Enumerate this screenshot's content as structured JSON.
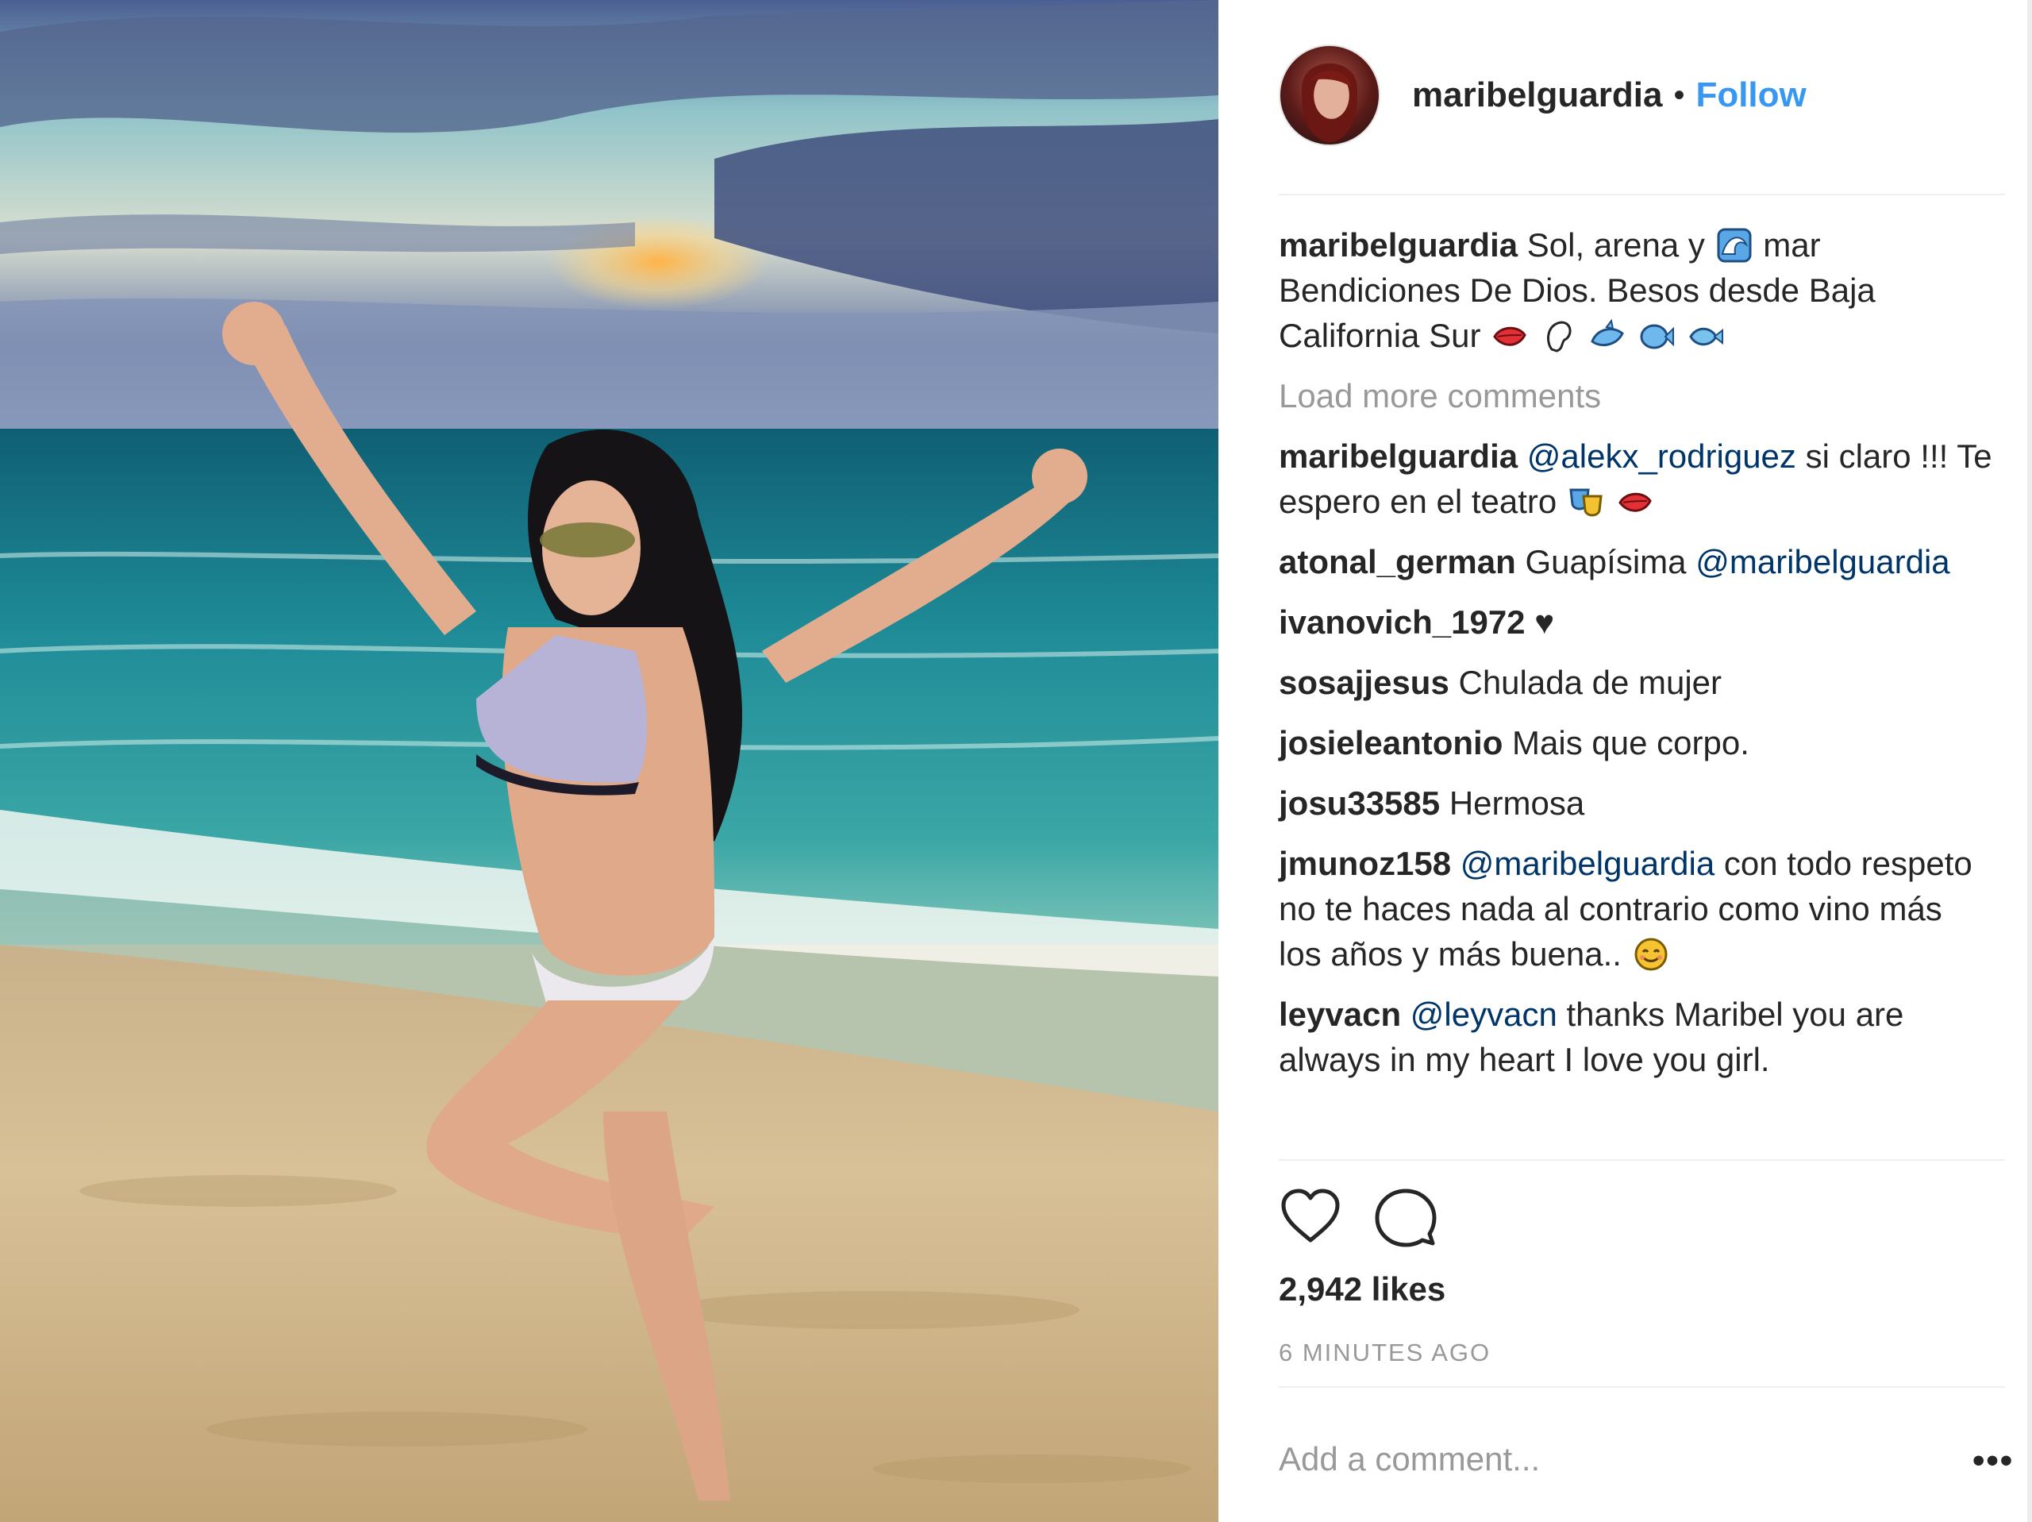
{
  "post": {
    "username": "maribelguardia",
    "separator": "•",
    "follow_label": "Follow",
    "avatar_icon": "profile-avatar",
    "caption": {
      "username": "maribelguardia",
      "text": "Sol, arena y",
      "text2": "mar Bendiciones De Dios. Besos desde Baja California Sur"
    },
    "load_more": "Load more comments",
    "comments": [
      {
        "user": "maribelguardia",
        "mention": "@alekx_rodriguez",
        "text": "si claro !!! Te espero en el teatro"
      },
      {
        "user": "atonal_german",
        "text": "Guapísima",
        "mention": "@maribelguardia"
      },
      {
        "user": "ivanovich_1972",
        "text": "♥"
      },
      {
        "user": "sosajjesus",
        "text": "Chulada de mujer"
      },
      {
        "user": "josieleantonio",
        "text": "Mais que corpo."
      },
      {
        "user": "josu33585",
        "text": "Hermosa"
      },
      {
        "user": "jmunoz158",
        "mention": "@maribelguardia",
        "text": "con todo respeto no te haces nada al contrario como vino más los años y más buena.."
      },
      {
        "user": "leyvacn",
        "mention": "@leyvacn",
        "text": "thanks Maribel you are always in my heart I love you girl."
      }
    ],
    "likes": "2,942 likes",
    "time": "6 MINUTES AGO",
    "add_comment_placeholder": "Add a comment...",
    "more_options": "•••",
    "icons": {
      "like": "heart-icon",
      "comment": "comment-bubble-icon",
      "options": "ellipsis-icon"
    },
    "colors": {
      "follow": "#3897f0",
      "mention": "#003569",
      "muted": "#999999",
      "text": "#262626"
    }
  }
}
